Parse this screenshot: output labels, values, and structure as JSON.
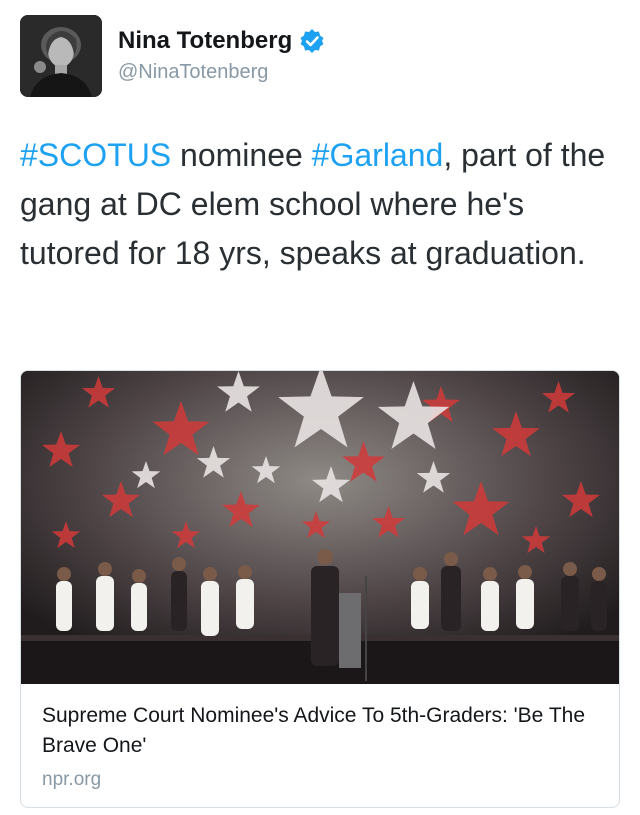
{
  "author": {
    "name": "Nina Totenberg",
    "handle": "@NinaTotenberg",
    "avatar_icon": "profile-photo",
    "verified_icon": "verified-badge-icon",
    "verified_color": "#1da1f2"
  },
  "tweet": {
    "segments": [
      {
        "text": "#SCOTUS",
        "type": "hashtag"
      },
      {
        "text": " nominee ",
        "type": "text"
      },
      {
        "text": "#Garland",
        "type": "hashtag"
      },
      {
        "text": ", part of the gang at DC elem school where he's tutored for 18 yrs, speaks at graduation.",
        "type": "text"
      }
    ],
    "hashtag_color": "#1da1f2"
  },
  "card": {
    "image_icon": "graduation-stage-photo",
    "title": "Supreme Court Nominee's Advice To 5th-Graders: 'Be The Brave One'",
    "domain": "npr.org"
  }
}
